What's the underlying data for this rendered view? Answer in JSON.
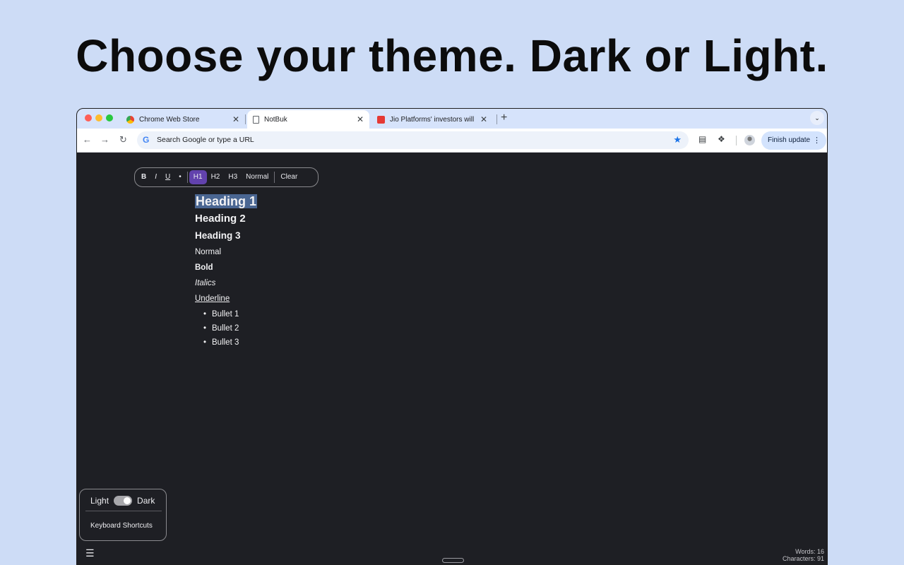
{
  "headline": "Choose your theme. Dark or Light.",
  "colors": {
    "background": "#cddcf6",
    "editor_background": "#1e1f24",
    "active_format": "#6242ad",
    "selection_highlight": "#4a6692"
  },
  "tabs": [
    {
      "title": "Chrome Web Store",
      "icon": "chrome-web-store-icon",
      "active": false
    },
    {
      "title": "NotBuk",
      "icon": "document-icon",
      "active": true
    },
    {
      "title": "Jio Platforms' investors will m",
      "icon": "news-site-icon",
      "active": false
    }
  ],
  "tab_close": "✕",
  "new_tab": "+",
  "omnibox": {
    "placeholder": "Search Google or type a URL"
  },
  "toolbar": {
    "finish_update": "Finish update"
  },
  "format_bar": {
    "items": [
      {
        "label": "B",
        "active": false
      },
      {
        "label": "I",
        "active": false
      },
      {
        "label": "U",
        "active": false
      },
      {
        "label": "•",
        "active": false
      },
      {
        "label": "H1",
        "active": true
      },
      {
        "label": "H2",
        "active": false
      },
      {
        "label": "H3",
        "active": false
      },
      {
        "label": "Normal",
        "active": false
      },
      {
        "label": "Clear",
        "active": false
      }
    ]
  },
  "document": {
    "heading1": "Heading 1",
    "heading2": "Heading 2",
    "heading3": "Heading 3",
    "normal": "Normal",
    "bold": "Bold",
    "italics": "Italics",
    "underline": "Underline",
    "bullets": [
      "Bullet 1",
      "Bullet 2",
      "Bullet 3"
    ]
  },
  "theme_panel": {
    "light_label": "Light",
    "dark_label": "Dark",
    "dark_mode_enabled": true,
    "shortcuts_label": "Keyboard Shortcuts"
  },
  "stats": {
    "words": "Words: 16",
    "characters": "Characters: 91"
  }
}
